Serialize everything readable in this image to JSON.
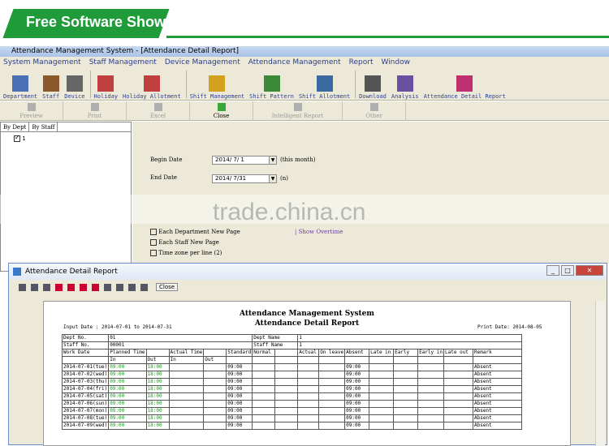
{
  "banner": {
    "text": "Free Software Show"
  },
  "window_title": "Attendance Management System - [Attendance Detail Report]",
  "menu": [
    "System Management",
    "Staff Management",
    "Device Management",
    "Attendance Management",
    "Report",
    "Window"
  ],
  "toolbar": [
    {
      "label": "Department",
      "icon": "department-icon"
    },
    {
      "label": "Staff",
      "icon": "staff-icon"
    },
    {
      "label": "Device",
      "icon": "device-icon"
    },
    {
      "label": "Holiday",
      "icon": "holiday-icon"
    },
    {
      "label": "Holiday Allotment",
      "icon": "holiday-allotment-icon"
    },
    {
      "label": "Shift Management",
      "icon": "shift-management-icon"
    },
    {
      "label": "Shift Pattern",
      "icon": "shift-pattern-icon"
    },
    {
      "label": "Shift Allotment",
      "icon": "shift-allotment-icon"
    },
    {
      "label": "Download",
      "icon": "download-icon"
    },
    {
      "label": "Analysis",
      "icon": "analysis-icon"
    },
    {
      "label": "Attendance Detail Report",
      "icon": "report-icon"
    }
  ],
  "toolbar2": [
    "Preview",
    "Print",
    "Excel",
    "Close",
    "Intelligent Report",
    "Other"
  ],
  "tree": {
    "tabs": [
      "By Dept",
      "By Staff"
    ],
    "node": "1"
  },
  "form": {
    "begin_label": "Begin Date",
    "begin_value": "2014/ 7/ 1",
    "begin_note": "(this month)",
    "end_label": "End Date",
    "end_value": "2014/ 7/31",
    "end_note": "(n)",
    "opt1": "Each Department New Page",
    "opt2": "Each Staff New Page",
    "opt3": "Time zone per line (2)",
    "opt4": "Show Overtime"
  },
  "watermark": "trade.china.cn",
  "report_window": {
    "title": "Attendance Detail Report",
    "close_label": "Close",
    "report_title": "Attendance Management System",
    "report_subtitle": "Attendance Detail Report",
    "input_date": "Input Date : 2014-07-01 to 2014-07-31",
    "print_date": "Print Date: 2014-08-05",
    "dept_no_label": "Dept No.",
    "dept_no": "01",
    "dept_name_label": "Dept Name",
    "dept_name": "1",
    "staff_no_label": "Staff No.",
    "staff_no": "00001",
    "staff_name_label": "Staff Name",
    "staff_name": "1",
    "headers": [
      "Work Date",
      "Planned Time",
      "",
      "Actual Time",
      "",
      "Standard",
      "Normal",
      "",
      "Actual",
      "On leave",
      "Absent",
      "Late in",
      "Early",
      "Early in",
      "Late out",
      "Remark"
    ],
    "subheaders": [
      "",
      "In",
      "Out",
      "In",
      "Out"
    ],
    "rows": [
      [
        "2014-07-01(tue)",
        "09:00",
        "18:00",
        "09:00",
        "09:00",
        "Absent"
      ],
      [
        "2014-07-02(wed)",
        "09:00",
        "18:00",
        "09:00",
        "09:00",
        "Absent"
      ],
      [
        "2014-07-03(thu)",
        "09:00",
        "18:00",
        "09:00",
        "09:00",
        "Absent"
      ],
      [
        "2014-07-04(fri)",
        "09:00",
        "18:00",
        "09:00",
        "09:00",
        "Absent"
      ],
      [
        "2014-07-05(sat)",
        "09:00",
        "18:00",
        "09:00",
        "09:00",
        "Absent"
      ],
      [
        "2014-07-06(sun)",
        "09:00",
        "18:00",
        "09:00",
        "09:00",
        "Absent"
      ],
      [
        "2014-07-07(mon)",
        "09:00",
        "18:00",
        "09:00",
        "09:00",
        "Absent"
      ],
      [
        "2014-07-08(tue)",
        "09:00",
        "18:00",
        "09:00",
        "09:00",
        "Absent"
      ],
      [
        "2014-07-09(wed)",
        "09:00",
        "18:00",
        "09:00",
        "09:00",
        "Absent"
      ]
    ]
  }
}
